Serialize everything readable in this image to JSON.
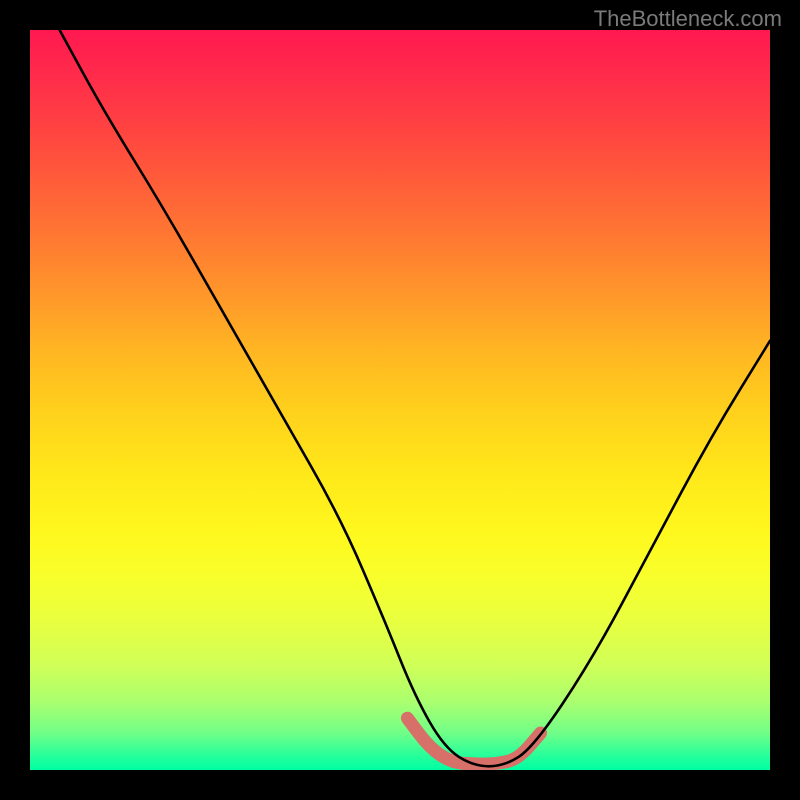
{
  "watermark": "TheBottleneck.com",
  "chart_data": {
    "type": "line",
    "title": "",
    "xlabel": "",
    "ylabel": "",
    "xlim": [
      0,
      100
    ],
    "ylim": [
      0,
      100
    ],
    "series": [
      {
        "name": "curve",
        "color": "#000000",
        "x": [
          4,
          10,
          18,
          26,
          34,
          42,
          48,
          52,
          56,
          60,
          64,
          68,
          76,
          84,
          92,
          100
        ],
        "values": [
          100,
          89,
          76,
          62,
          48,
          34,
          20,
          10,
          3,
          0.5,
          0.5,
          3,
          15,
          30,
          45,
          58
        ]
      }
    ],
    "annotations": [
      {
        "name": "highlight",
        "color": "#d67068",
        "x": [
          51,
          54,
          57,
          60,
          63,
          66,
          69
        ],
        "values": [
          7,
          3,
          1,
          0.8,
          0.8,
          1.5,
          5
        ]
      }
    ],
    "gradient": {
      "direction": "vertical",
      "stops": [
        {
          "pos": 0,
          "color": "#ff1850"
        },
        {
          "pos": 14,
          "color": "#ff4540"
        },
        {
          "pos": 30,
          "color": "#ff8030"
        },
        {
          "pos": 44,
          "color": "#ffb822"
        },
        {
          "pos": 60,
          "color": "#ffe81a"
        },
        {
          "pos": 74,
          "color": "#f8ff2c"
        },
        {
          "pos": 86,
          "color": "#cfff58"
        },
        {
          "pos": 95,
          "color": "#70ff88"
        },
        {
          "pos": 100,
          "color": "#00ffa3"
        }
      ]
    }
  }
}
